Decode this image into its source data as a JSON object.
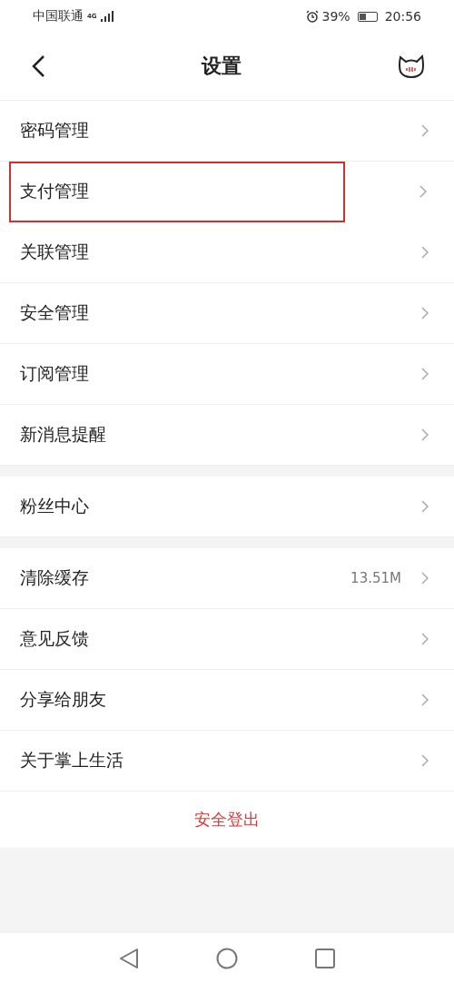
{
  "status_bar": {
    "carrier": "中国联通",
    "network": "4G",
    "battery_text": "39%",
    "time": "20:56"
  },
  "header": {
    "title": "设置"
  },
  "groups": [
    {
      "items": [
        {
          "label": "密码管理",
          "highlighted": false
        },
        {
          "label": "支付管理",
          "highlighted": true
        },
        {
          "label": "关联管理",
          "highlighted": false
        },
        {
          "label": "安全管理",
          "highlighted": false
        },
        {
          "label": "订阅管理",
          "highlighted": false
        },
        {
          "label": "新消息提醒",
          "highlighted": false
        }
      ]
    },
    {
      "items": [
        {
          "label": "粉丝中心",
          "highlighted": false
        }
      ]
    },
    {
      "items": [
        {
          "label": "清除缓存",
          "value": "13.51M",
          "highlighted": false
        },
        {
          "label": "意见反馈",
          "highlighted": false
        },
        {
          "label": "分享给朋友",
          "highlighted": false
        },
        {
          "label": "关于掌上生活",
          "highlighted": false
        }
      ]
    }
  ],
  "logout": {
    "label": "安全登出"
  }
}
